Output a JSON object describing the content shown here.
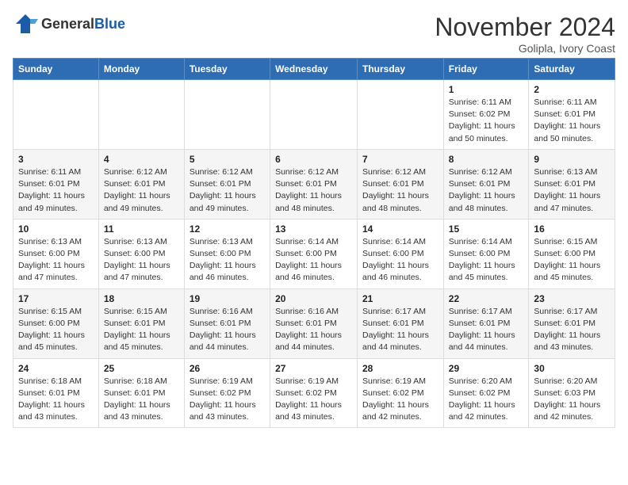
{
  "header": {
    "logo_general": "General",
    "logo_blue": "Blue",
    "month_title": "November 2024",
    "location": "Golipla, Ivory Coast"
  },
  "weekdays": [
    "Sunday",
    "Monday",
    "Tuesday",
    "Wednesday",
    "Thursday",
    "Friday",
    "Saturday"
  ],
  "weeks": [
    [
      {
        "day": "",
        "info": ""
      },
      {
        "day": "",
        "info": ""
      },
      {
        "day": "",
        "info": ""
      },
      {
        "day": "",
        "info": ""
      },
      {
        "day": "",
        "info": ""
      },
      {
        "day": "1",
        "info": "Sunrise: 6:11 AM\nSunset: 6:02 PM\nDaylight: 11 hours and 50 minutes."
      },
      {
        "day": "2",
        "info": "Sunrise: 6:11 AM\nSunset: 6:01 PM\nDaylight: 11 hours and 50 minutes."
      }
    ],
    [
      {
        "day": "3",
        "info": "Sunrise: 6:11 AM\nSunset: 6:01 PM\nDaylight: 11 hours and 49 minutes."
      },
      {
        "day": "4",
        "info": "Sunrise: 6:12 AM\nSunset: 6:01 PM\nDaylight: 11 hours and 49 minutes."
      },
      {
        "day": "5",
        "info": "Sunrise: 6:12 AM\nSunset: 6:01 PM\nDaylight: 11 hours and 49 minutes."
      },
      {
        "day": "6",
        "info": "Sunrise: 6:12 AM\nSunset: 6:01 PM\nDaylight: 11 hours and 48 minutes."
      },
      {
        "day": "7",
        "info": "Sunrise: 6:12 AM\nSunset: 6:01 PM\nDaylight: 11 hours and 48 minutes."
      },
      {
        "day": "8",
        "info": "Sunrise: 6:12 AM\nSunset: 6:01 PM\nDaylight: 11 hours and 48 minutes."
      },
      {
        "day": "9",
        "info": "Sunrise: 6:13 AM\nSunset: 6:01 PM\nDaylight: 11 hours and 47 minutes."
      }
    ],
    [
      {
        "day": "10",
        "info": "Sunrise: 6:13 AM\nSunset: 6:00 PM\nDaylight: 11 hours and 47 minutes."
      },
      {
        "day": "11",
        "info": "Sunrise: 6:13 AM\nSunset: 6:00 PM\nDaylight: 11 hours and 47 minutes."
      },
      {
        "day": "12",
        "info": "Sunrise: 6:13 AM\nSunset: 6:00 PM\nDaylight: 11 hours and 46 minutes."
      },
      {
        "day": "13",
        "info": "Sunrise: 6:14 AM\nSunset: 6:00 PM\nDaylight: 11 hours and 46 minutes."
      },
      {
        "day": "14",
        "info": "Sunrise: 6:14 AM\nSunset: 6:00 PM\nDaylight: 11 hours and 46 minutes."
      },
      {
        "day": "15",
        "info": "Sunrise: 6:14 AM\nSunset: 6:00 PM\nDaylight: 11 hours and 45 minutes."
      },
      {
        "day": "16",
        "info": "Sunrise: 6:15 AM\nSunset: 6:00 PM\nDaylight: 11 hours and 45 minutes."
      }
    ],
    [
      {
        "day": "17",
        "info": "Sunrise: 6:15 AM\nSunset: 6:00 PM\nDaylight: 11 hours and 45 minutes."
      },
      {
        "day": "18",
        "info": "Sunrise: 6:15 AM\nSunset: 6:01 PM\nDaylight: 11 hours and 45 minutes."
      },
      {
        "day": "19",
        "info": "Sunrise: 6:16 AM\nSunset: 6:01 PM\nDaylight: 11 hours and 44 minutes."
      },
      {
        "day": "20",
        "info": "Sunrise: 6:16 AM\nSunset: 6:01 PM\nDaylight: 11 hours and 44 minutes."
      },
      {
        "day": "21",
        "info": "Sunrise: 6:17 AM\nSunset: 6:01 PM\nDaylight: 11 hours and 44 minutes."
      },
      {
        "day": "22",
        "info": "Sunrise: 6:17 AM\nSunset: 6:01 PM\nDaylight: 11 hours and 44 minutes."
      },
      {
        "day": "23",
        "info": "Sunrise: 6:17 AM\nSunset: 6:01 PM\nDaylight: 11 hours and 43 minutes."
      }
    ],
    [
      {
        "day": "24",
        "info": "Sunrise: 6:18 AM\nSunset: 6:01 PM\nDaylight: 11 hours and 43 minutes."
      },
      {
        "day": "25",
        "info": "Sunrise: 6:18 AM\nSunset: 6:01 PM\nDaylight: 11 hours and 43 minutes."
      },
      {
        "day": "26",
        "info": "Sunrise: 6:19 AM\nSunset: 6:02 PM\nDaylight: 11 hours and 43 minutes."
      },
      {
        "day": "27",
        "info": "Sunrise: 6:19 AM\nSunset: 6:02 PM\nDaylight: 11 hours and 43 minutes."
      },
      {
        "day": "28",
        "info": "Sunrise: 6:19 AM\nSunset: 6:02 PM\nDaylight: 11 hours and 42 minutes."
      },
      {
        "day": "29",
        "info": "Sunrise: 6:20 AM\nSunset: 6:02 PM\nDaylight: 11 hours and 42 minutes."
      },
      {
        "day": "30",
        "info": "Sunrise: 6:20 AM\nSunset: 6:03 PM\nDaylight: 11 hours and 42 minutes."
      }
    ]
  ]
}
